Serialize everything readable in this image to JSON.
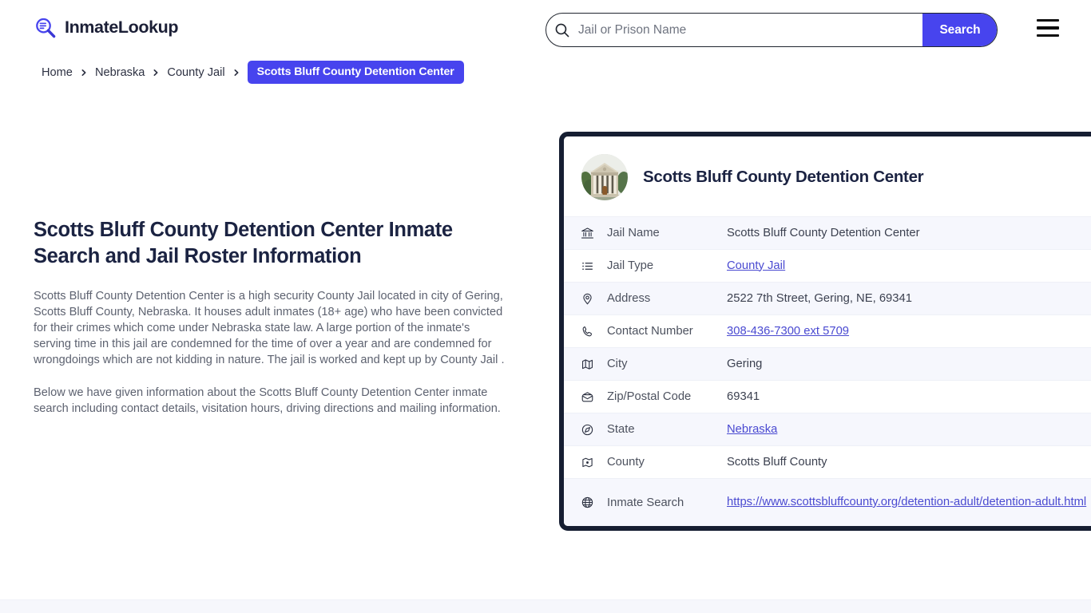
{
  "header": {
    "brand_name": "InmateLookup",
    "logo_icon": "magnifier-list-icon",
    "search": {
      "placeholder": "Jail or Prison Name",
      "value": "",
      "icon": "search-icon",
      "button_label": "Search"
    },
    "menu_icon": "hamburger-menu-icon",
    "accent_color": "#4744ee"
  },
  "breadcrumb": {
    "separator": "chevron-right-icon",
    "items": [
      {
        "label": "Home",
        "current": false
      },
      {
        "label": "Nebraska",
        "current": false
      },
      {
        "label": "County Jail",
        "current": false
      },
      {
        "label": "Scotts Bluff County Detention Center",
        "current": true
      }
    ]
  },
  "main": {
    "title": "Scotts Bluff County Detention Center Inmate Search and Jail Roster Information",
    "paragraphs": [
      "Scotts Bluff County Detention Center is a high security County Jail located in city of Gering, Scotts Bluff County, Nebraska. It houses adult inmates (18+ age) who have been convicted for their crimes which come under Nebraska state law. A large portion of the inmate's serving time in this jail are condemned for the time of over a year and are condemned for wrongdoings which are not kidding in nature. The jail is worked and kept up by County Jail .",
      "Below we have given information about the Scotts Bluff County Detention Center inmate search including contact details, visitation hours, driving directions and mailing information."
    ]
  },
  "card": {
    "photo_icon": "courthouse-building-photo",
    "title": "Scotts Bluff County Detention Center",
    "border_color": "#161e32",
    "rows": [
      {
        "icon": "bank-building-icon",
        "label": "Jail Name",
        "value": "Scotts Bluff County Detention Center",
        "link": false
      },
      {
        "icon": "list-icon",
        "label": "Jail Type",
        "value": "County Jail",
        "link": true
      },
      {
        "icon": "map-pin-icon",
        "label": "Address",
        "value": "2522 7th Street, Gering, NE, 69341",
        "link": false
      },
      {
        "icon": "phone-icon",
        "label": "Contact Number",
        "value": "308-436-7300 ext 5709",
        "link": true
      },
      {
        "icon": "map-icon",
        "label": "City",
        "value": "Gering",
        "link": false
      },
      {
        "icon": "envelope-icon",
        "label": "Zip/Postal Code",
        "value": "69341",
        "link": false
      },
      {
        "icon": "globe-compass-icon",
        "label": "State",
        "value": "Nebraska",
        "link": true
      },
      {
        "icon": "map-location-icon",
        "label": "County",
        "value": "Scotts Bluff County",
        "link": false
      },
      {
        "icon": "globe-icon",
        "label": "Inmate Search",
        "value": "https://www.scottsbluffcounty.org/detention-adult/detention-adult.html",
        "link": true
      }
    ]
  }
}
